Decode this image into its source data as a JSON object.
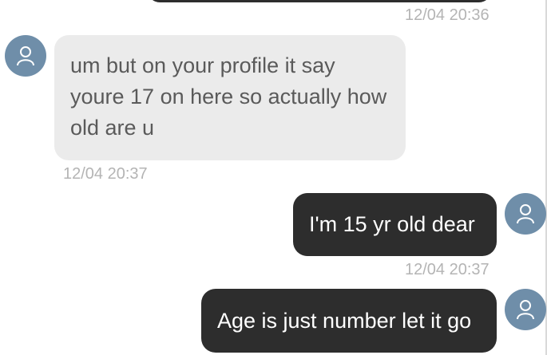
{
  "messages": [
    {
      "sender": "them",
      "text": "um but on your profile it say youre 17 on here so actually how old are u",
      "timestamp": "12/04 20:37",
      "avatar_icon": "user-icon"
    },
    {
      "sender": "me",
      "text": "I'm 15 yr old dear",
      "timestamp": "12/04 20:37",
      "avatar_icon": "user-icon"
    },
    {
      "sender": "me",
      "text": "Age is just number let it go",
      "avatar_icon": "user-icon"
    }
  ],
  "previous_message": {
    "timestamp": "12/04 20:36"
  },
  "colors": {
    "avatar_bg": "#6f8ea9",
    "incoming_bubble": "#ebebeb",
    "outgoing_bubble": "#2d2d2d",
    "incoming_text": "#5a5a5a",
    "outgoing_text": "#ffffff",
    "timestamp": "#b4b4b4"
  }
}
